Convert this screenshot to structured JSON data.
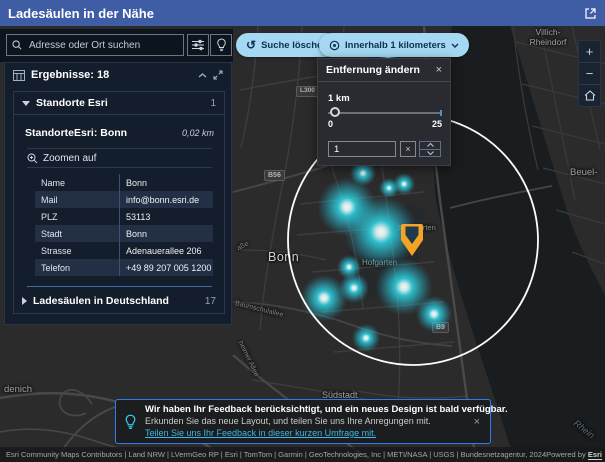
{
  "app": {
    "title": "Ladesäulen in der Nähe"
  },
  "search": {
    "placeholder": "Adresse oder Ort suchen"
  },
  "toolbar": {
    "clear_button": "Suche löschen",
    "radius_button": "Innerhalb 1 kilometers"
  },
  "results_panel": {
    "header": "Ergebnisse: 18",
    "group1": {
      "label": "Standorte Esri",
      "count": "1"
    },
    "item": {
      "title": "StandorteEsri: Bonn",
      "distance": "0,02 km",
      "zoom_action": "Zoomen auf",
      "fields": [
        {
          "label": "Name",
          "value": "Bonn"
        },
        {
          "label": "Mail",
          "value": "info@bonn.esri.de"
        },
        {
          "label": "PLZ",
          "value": "53113"
        },
        {
          "label": "Stadt",
          "value": "Bonn"
        },
        {
          "label": "Strasse",
          "value": "Adenauerallee 206"
        },
        {
          "label": "Telefon",
          "value": "+49 89 207 005 1200"
        }
      ]
    },
    "group2": {
      "label": "Ladesäulen in Deutschland",
      "count": "17"
    }
  },
  "distance_dialog": {
    "title": "Entfernung ändern",
    "close": "×",
    "value_label": "1 km",
    "min": "0",
    "max": "25",
    "input_value": "1",
    "clear": "×"
  },
  "map_labels": {
    "villich": "Villich-",
    "rheindorf": "Rheindorf",
    "beuel": "Beuel-",
    "bonn": "Bonn",
    "hofgarten": "Hofgarten",
    "stadtgarten": "Stadtgarten",
    "suedstadt": "Südstadt",
    "endenich": "denich",
    "street1": "Baumschulallee",
    "street2": "heimer Allee",
    "street3": "aße",
    "river": "Rhein",
    "shield_b56": "B56",
    "shield_b9": "B9",
    "shield_l300": "L300"
  },
  "map_controls": {
    "zoom_in": "+",
    "zoom_out": "−"
  },
  "feedback_banner": {
    "title": "Wir haben Ihr Feedback berücksichtigt, und ein neues Design ist bald verfügbar.",
    "subtitle": "Erkunden Sie das neue Layout, und teilen Sie uns Ihre Anregungen mit.",
    "link": "Teilen Sie uns Ihr Feedback in dieser kurzen Umfrage mit.",
    "close": "×"
  },
  "attribution": {
    "sources": "Esri Community Maps Contributors | Land NRW | LVermGeo RP | Esri | TomTom | Garmin | GeoTechnologies, Inc | METI/NASA | USGS | Bundesnetzagentur, 2024",
    "powered_by": "Powered by",
    "brand": "Esri"
  },
  "colors": {
    "header_blue": "#3e5da5",
    "pill_blue": "#a5d8f3",
    "heat_cyan": "#2fe1f2",
    "marker_orange": "#f5a325",
    "banner_border": "#2e7bf2"
  }
}
